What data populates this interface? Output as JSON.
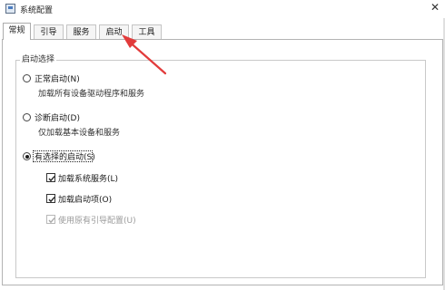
{
  "window": {
    "title": "系统配置",
    "close_glyph": "✕"
  },
  "tabs": [
    {
      "label": "常规",
      "active": true
    },
    {
      "label": "引导",
      "active": false
    },
    {
      "label": "服务",
      "active": false
    },
    {
      "label": "启动",
      "active": false
    },
    {
      "label": "工具",
      "active": false
    }
  ],
  "startup_group": {
    "legend": "启动选择",
    "normal": {
      "label": "正常启动(N)",
      "description": "加载所有设备驱动程序和服务",
      "selected": false
    },
    "diagnostic": {
      "label": "诊断启动(D)",
      "description": "仅加载基本设备和服务",
      "selected": false
    },
    "selective": {
      "label": "有选择的启动(S)",
      "selected": true,
      "options": [
        {
          "label": "加载系统服务(L)",
          "checked": true,
          "enabled": true
        },
        {
          "label": "加载启动项(O)",
          "checked": true,
          "enabled": true
        },
        {
          "label": "使用原有引导配置(U)",
          "checked": true,
          "enabled": false
        }
      ]
    }
  },
  "colors": {
    "annotation_arrow": "#e23b3b",
    "checkmark": "#222222",
    "disabled": "#9a9a9a"
  }
}
